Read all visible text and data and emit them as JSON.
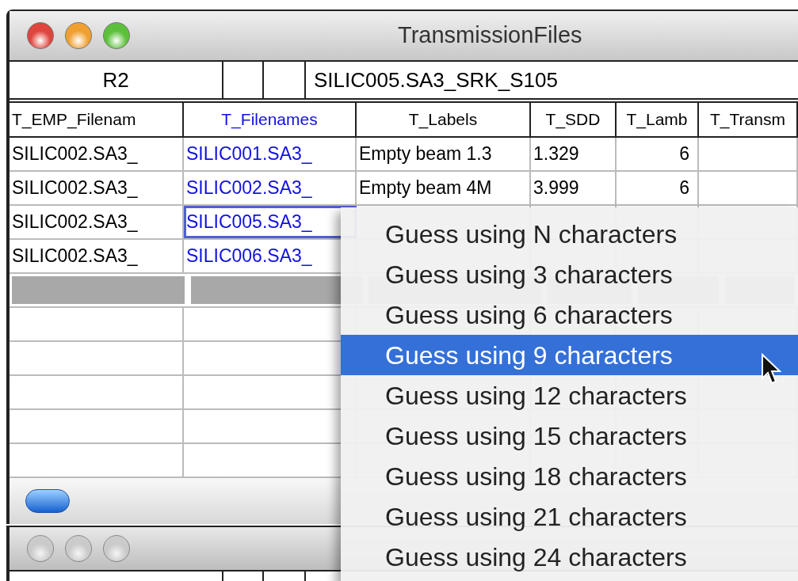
{
  "window": {
    "title": "TransmissionFiles",
    "active": true
  },
  "top_row": {
    "name": "R2",
    "value": "SILIC005.SA3_SRK_S105"
  },
  "table": {
    "columns": [
      {
        "label": "T_EMP_Filenam",
        "highlighted": false
      },
      {
        "label": "T_Filenames",
        "highlighted": true
      },
      {
        "label": "T_Labels",
        "highlighted": false
      },
      {
        "label": "T_SDD",
        "highlighted": false
      },
      {
        "label": "T_Lamb",
        "highlighted": false
      },
      {
        "label": "T_Transm",
        "highlighted": false
      }
    ],
    "rows": [
      {
        "focused": false,
        "cells": [
          "SILIC002.SA3_",
          "SILIC001.SA3_",
          "Empty beam 1.3",
          "1.329",
          "6"
        ]
      },
      {
        "focused": false,
        "cells": [
          "SILIC002.SA3_",
          "SILIC002.SA3_",
          "Empty beam 4M",
          "3.999",
          "6"
        ]
      },
      {
        "focused": true,
        "cells": [
          "SILIC002.SA3_",
          "SILIC005.SA3_"
        ]
      },
      {
        "focused": false,
        "cells": [
          "SILIC002.SA3_",
          "SILIC006.SA3_"
        ]
      }
    ]
  },
  "menu": {
    "items": [
      {
        "label": "Guess using N characters",
        "selected": false
      },
      {
        "label": "Guess using 3 characters",
        "selected": false
      },
      {
        "label": "Guess using 6 characters",
        "selected": false
      },
      {
        "label": "Guess using 9 characters",
        "selected": true
      },
      {
        "label": "Guess using 12 characters",
        "selected": false
      },
      {
        "label": "Guess using 15 characters",
        "selected": false
      },
      {
        "label": "Guess using 18 characters",
        "selected": false
      },
      {
        "label": "Guess using 21 characters",
        "selected": false
      },
      {
        "label": "Guess using 24 characters",
        "selected": false
      }
    ]
  },
  "second_window": {
    "active": false
  }
}
